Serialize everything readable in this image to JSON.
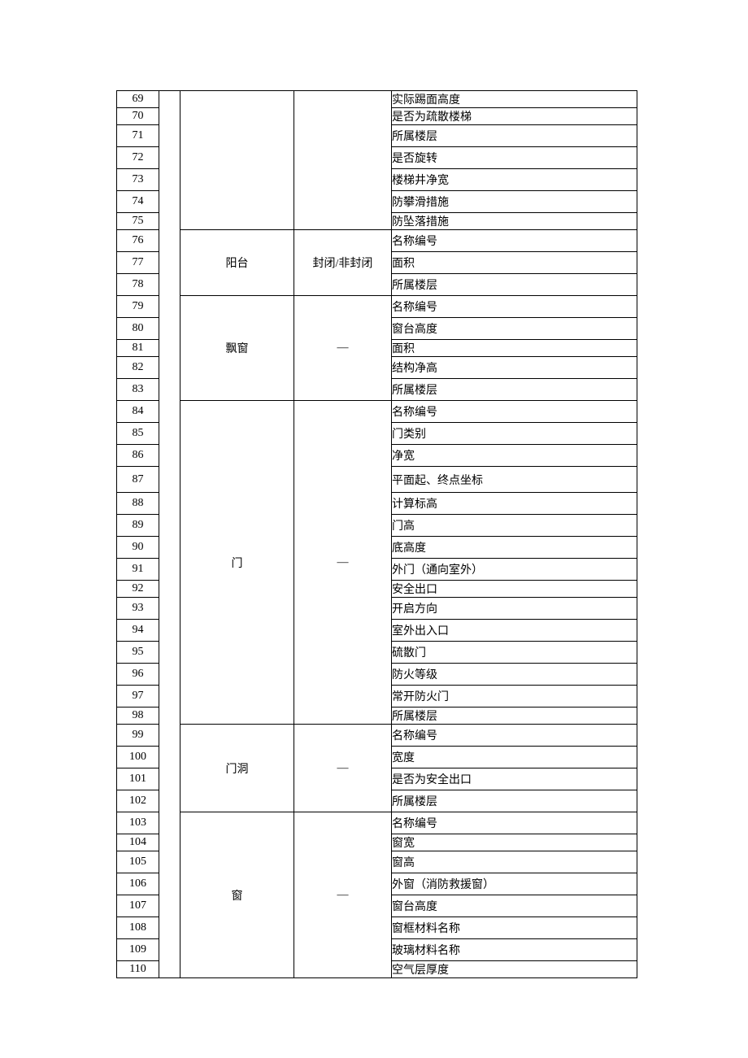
{
  "groups": [
    {
      "category": "",
      "note": "",
      "start": 69,
      "rows": [
        {
          "n": 69,
          "label": "实际踢面高度",
          "h": "short",
          "dashed": true
        },
        {
          "n": 70,
          "label": "是否为疏散楼梯",
          "h": "short",
          "dashed": true
        },
        {
          "n": 71,
          "label": "所属楼层",
          "h": "normal",
          "dashed": true
        },
        {
          "n": 72,
          "label": "是否旋转",
          "h": "normal",
          "dashed": true
        },
        {
          "n": 73,
          "label": "楼梯井净宽",
          "h": "normal",
          "dashed": true
        },
        {
          "n": 74,
          "label": "防攀滑措施",
          "h": "normal",
          "dashed": true
        },
        {
          "n": 75,
          "label": "防坠落措施",
          "h": "short",
          "dashed": false
        }
      ]
    },
    {
      "category": "阳台",
      "note": "封闭/非封闭",
      "rows": [
        {
          "n": 76,
          "label": "名称编号",
          "h": "normal",
          "dashed": true
        },
        {
          "n": 77,
          "label": "面积",
          "h": "normal",
          "dashed": true
        },
        {
          "n": 78,
          "label": "所属楼层",
          "h": "normal",
          "dashed": false
        }
      ]
    },
    {
      "category": "飘窗",
      "note": "—",
      "rows": [
        {
          "n": 79,
          "label": "名称编号",
          "h": "normal",
          "dashed": true
        },
        {
          "n": 80,
          "label": "窗台高度",
          "h": "normal",
          "dashed": true
        },
        {
          "n": 81,
          "label": "面积",
          "h": "short",
          "dashed": true
        },
        {
          "n": 82,
          "label": "结构净高",
          "h": "normal",
          "dashed": true
        },
        {
          "n": 83,
          "label": "所属楼层",
          "h": "normal",
          "dashed": false
        }
      ]
    },
    {
      "category": "门",
      "note": "—",
      "rows": [
        {
          "n": 84,
          "label": "名称编号",
          "h": "normal",
          "dashed": true
        },
        {
          "n": 85,
          "label": "门类别",
          "h": "normal",
          "dashed": true
        },
        {
          "n": 86,
          "label": "净宽",
          "h": "normal",
          "dashed": true
        },
        {
          "n": 87,
          "label": "平面起、终点坐标",
          "h": "tall",
          "dashed": true
        },
        {
          "n": 88,
          "label": "计算标高",
          "h": "normal",
          "dashed": true
        },
        {
          "n": 89,
          "label": "门高",
          "h": "normal",
          "dashed": true
        },
        {
          "n": 90,
          "label": "底高度",
          "h": "normal",
          "dashed": true
        },
        {
          "n": 91,
          "label": "外门（通向室外）",
          "h": "normal",
          "dashed": true
        },
        {
          "n": 92,
          "label": "安全出口",
          "h": "short",
          "dashed": true
        },
        {
          "n": 93,
          "label": "开启方向",
          "h": "normal",
          "dashed": true
        },
        {
          "n": 94,
          "label": "室外出入口",
          "h": "normal",
          "dashed": true
        },
        {
          "n": 95,
          "label": "硫散门",
          "h": "normal",
          "dashed": true
        },
        {
          "n": 96,
          "label": "防火等级",
          "h": "normal",
          "dashed": true
        },
        {
          "n": 97,
          "label": "常开防火门",
          "h": "normal",
          "dashed": true
        },
        {
          "n": 98,
          "label": "所属楼层",
          "h": "short",
          "dashed": false
        }
      ]
    },
    {
      "category": "门洞",
      "note": "—",
      "rows": [
        {
          "n": 99,
          "label": "名称编号",
          "h": "normal",
          "dashed": true
        },
        {
          "n": 100,
          "label": "宽度",
          "h": "normal",
          "dashed": true
        },
        {
          "n": 101,
          "label": "是否为安全出口",
          "h": "normal",
          "dashed": true
        },
        {
          "n": 102,
          "label": "所属楼层",
          "h": "normal",
          "dashed": false
        }
      ]
    },
    {
      "category": "窗",
      "note": "—",
      "rows": [
        {
          "n": 103,
          "label": "名称编号",
          "h": "normal",
          "dashed": true
        },
        {
          "n": 104,
          "label": "窗宽",
          "h": "short",
          "dashed": true
        },
        {
          "n": 105,
          "label": "窗高",
          "h": "normal",
          "dashed": true
        },
        {
          "n": 106,
          "label": "外窗（消防救援窗）",
          "h": "normal",
          "dashed": true
        },
        {
          "n": 107,
          "label": "窗台高度",
          "h": "normal",
          "dashed": true
        },
        {
          "n": 108,
          "label": "窗框材料名称",
          "h": "normal",
          "dashed": true
        },
        {
          "n": 109,
          "label": "玻璃材料名称",
          "h": "normal",
          "dashed": true
        },
        {
          "n": 110,
          "label": "空气层厚度",
          "h": "short",
          "dashed": false
        }
      ]
    }
  ]
}
